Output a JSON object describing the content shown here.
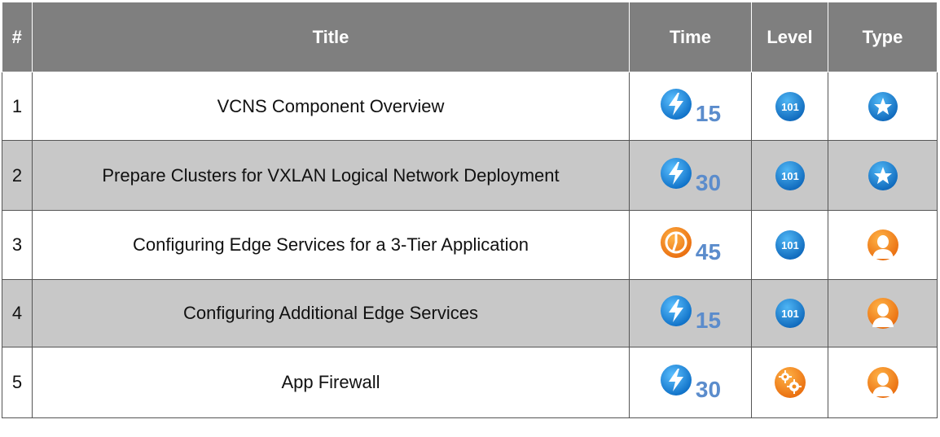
{
  "header": {
    "num": "#",
    "title": "Title",
    "time": "Time",
    "level": "Level",
    "type": "Type"
  },
  "rows": [
    {
      "num": "1",
      "title": "VCNS Component Overview",
      "time": "15",
      "time_icon": "lightning-icon",
      "level_icon": "level-101-icon",
      "level_text": "101",
      "type_icon": "star-icon"
    },
    {
      "num": "2",
      "title": "Prepare Clusters for VXLAN Logical Network Deployment",
      "time": "30",
      "time_icon": "lightning-icon",
      "level_icon": "level-101-icon",
      "level_text": "101",
      "type_icon": "star-icon"
    },
    {
      "num": "3",
      "title": "Configuring Edge Services for a 3-Tier Application",
      "time": "45",
      "time_icon": "clock-icon",
      "level_icon": "level-101-icon",
      "level_text": "101",
      "type_icon": "person-icon"
    },
    {
      "num": "4",
      "title": "Configuring Additional Edge Services",
      "time": "15",
      "time_icon": "lightning-icon",
      "level_icon": "level-101-icon",
      "level_text": "101",
      "type_icon": "person-icon"
    },
    {
      "num": "5",
      "title": "App Firewall",
      "time": "30",
      "time_icon": "lightning-icon",
      "level_icon": "gears-icon",
      "type_icon": "person-icon"
    }
  ],
  "colors": {
    "header_bg": "#7f7f7f",
    "shaded_row": "#c8c8c8",
    "time_text": "#5b8ccc",
    "blue_icon": "#1a8fe0",
    "orange_icon": "#f08a1c"
  }
}
